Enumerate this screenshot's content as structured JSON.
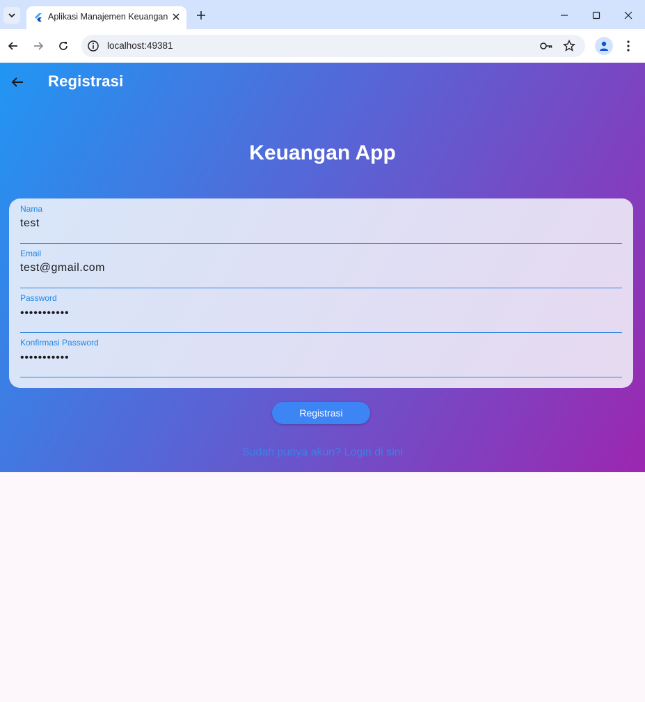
{
  "browser": {
    "tab_title": "Aplikasi Manajemen Keuangan",
    "url": "localhost:49381"
  },
  "app": {
    "appbar_title": "Registrasi",
    "heading": "Keuangan App",
    "gradient": {
      "start": "#2196f3",
      "end": "#9c27b0"
    },
    "fields": [
      {
        "label": "Nama",
        "value": "test"
      },
      {
        "label": "Email",
        "value": "test@gmail.com"
      },
      {
        "label": "Password",
        "value": "•••••••••••"
      },
      {
        "label": "Konfirmasi Password",
        "value": "•••••••••••"
      }
    ],
    "register_button": "Registrasi",
    "login_link": "Sudah punya akun? Login di sini",
    "accent": "#1e88e5"
  }
}
